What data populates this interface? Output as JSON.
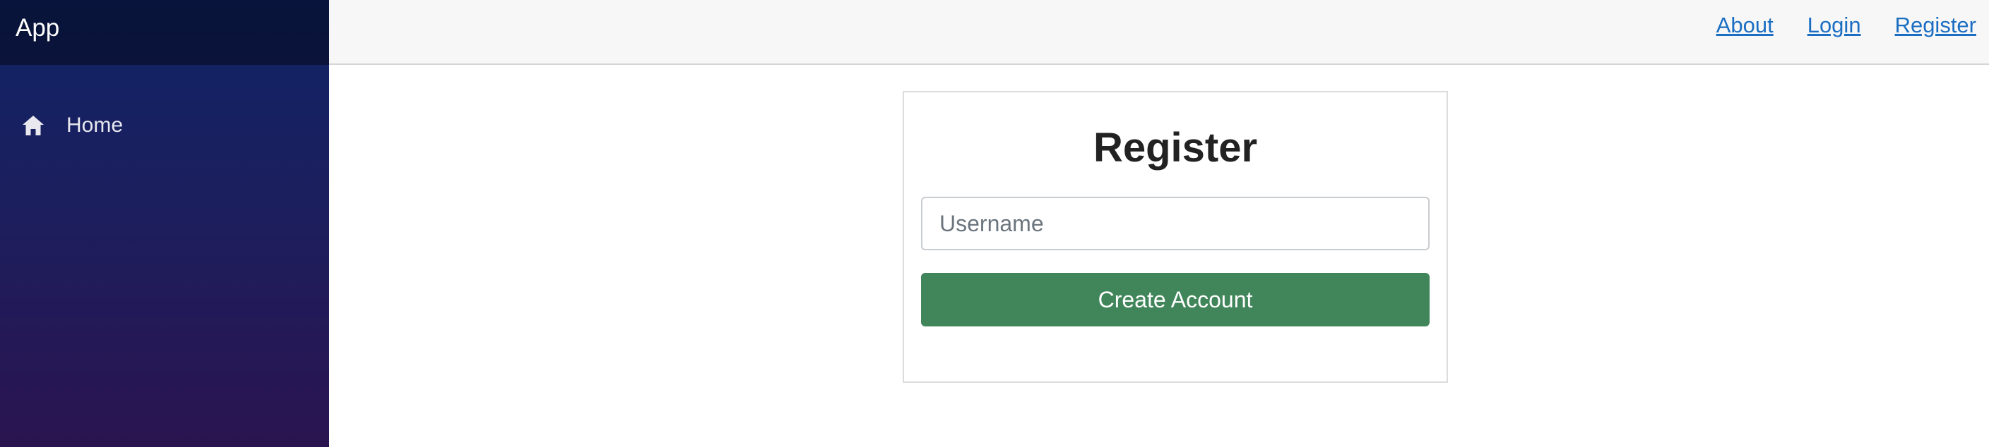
{
  "app": {
    "brand": "App"
  },
  "sidebar": {
    "items": [
      {
        "label": "Home",
        "icon": "home-icon"
      }
    ]
  },
  "header": {
    "links": [
      {
        "label": "About"
      },
      {
        "label": "Login"
      },
      {
        "label": "Register"
      }
    ]
  },
  "main": {
    "form": {
      "title": "Register",
      "username": {
        "value": "",
        "placeholder": "Username"
      },
      "submit_label": "Create Account"
    }
  },
  "colors": {
    "link": "#1b6ec2",
    "primary_button": "#41865a",
    "sidebar_top": "#0f2366",
    "sidebar_bottom": "#2a1450",
    "header_bg": "#f7f7f7"
  }
}
